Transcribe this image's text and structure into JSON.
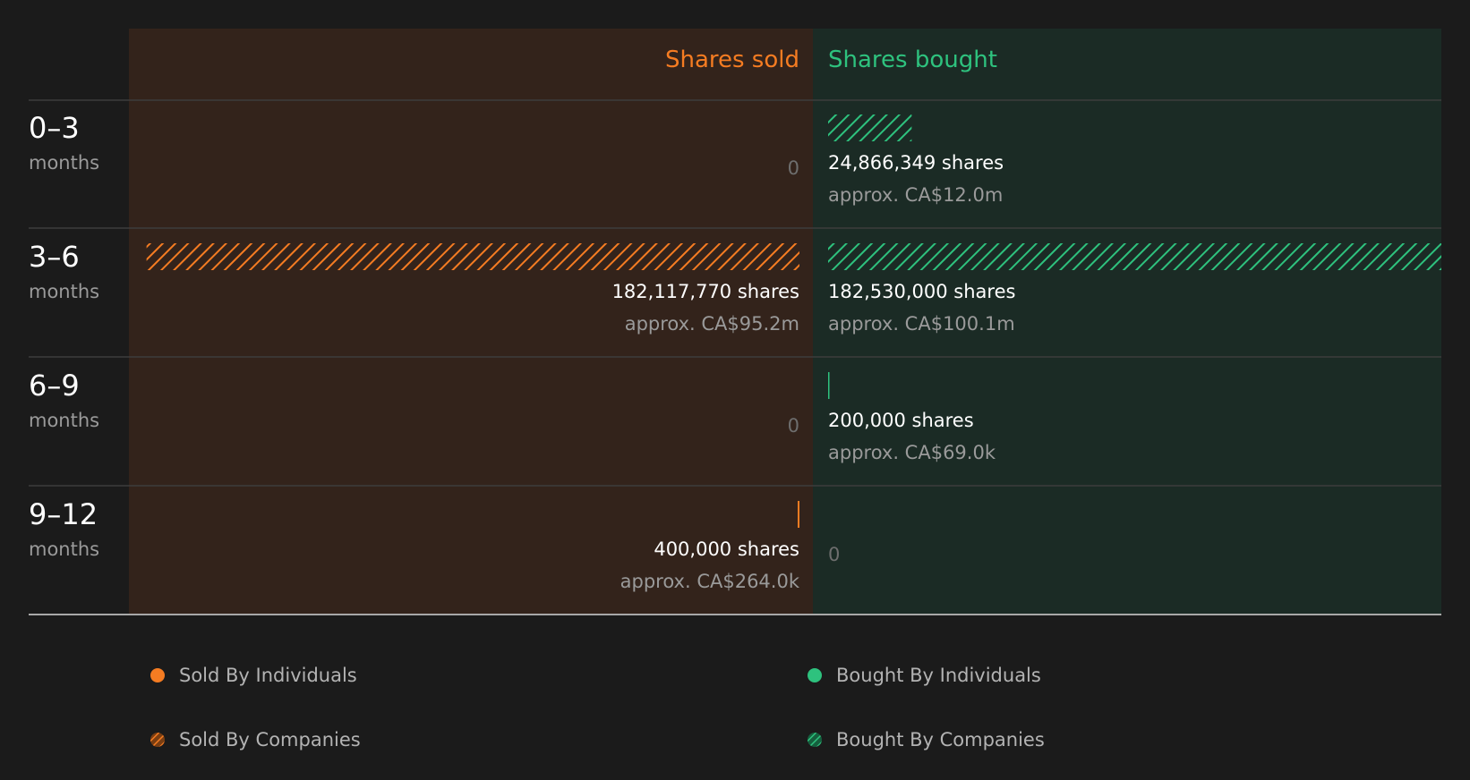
{
  "colors": {
    "sold": "#f57c22",
    "bought": "#2ec27e",
    "sold_panel": "#33231b",
    "bought_panel": "#1b2b25"
  },
  "chart_data": {
    "type": "bar",
    "orientation": "horizontal-diverging",
    "columns": {
      "sold": "Shares sold",
      "bought": "Shares bought"
    },
    "periods": [
      {
        "range": "0–3",
        "unit": "months",
        "sold": {
          "shares": 0,
          "label": "0",
          "approx": ""
        },
        "bought": {
          "shares": 24866349,
          "label": "24,866,349 shares",
          "approx": "approx. CA$12.0m"
        }
      },
      {
        "range": "3–6",
        "unit": "months",
        "sold": {
          "shares": 182117770,
          "label": "182,117,770 shares",
          "approx": "approx. CA$95.2m"
        },
        "bought": {
          "shares": 182530000,
          "label": "182,530,000 shares",
          "approx": "approx. CA$100.1m"
        }
      },
      {
        "range": "6–9",
        "unit": "months",
        "sold": {
          "shares": 0,
          "label": "0",
          "approx": ""
        },
        "bought": {
          "shares": 200000,
          "label": "200,000 shares",
          "approx": "approx. CA$69.0k"
        }
      },
      {
        "range": "9–12",
        "unit": "months",
        "sold": {
          "shares": 400000,
          "label": "400,000 shares",
          "approx": "approx. CA$264.0k"
        },
        "bought": {
          "shares": 0,
          "label": "0",
          "approx": ""
        }
      }
    ],
    "legend": [
      {
        "label": "Sold By Individuals",
        "side": "sold",
        "pattern": "solid"
      },
      {
        "label": "Bought By Individuals",
        "side": "bought",
        "pattern": "solid"
      },
      {
        "label": "Sold By Companies",
        "side": "sold",
        "pattern": "hatched"
      },
      {
        "label": "Bought By Companies",
        "side": "bought",
        "pattern": "hatched"
      }
    ],
    "bar_pattern": "hatched"
  }
}
